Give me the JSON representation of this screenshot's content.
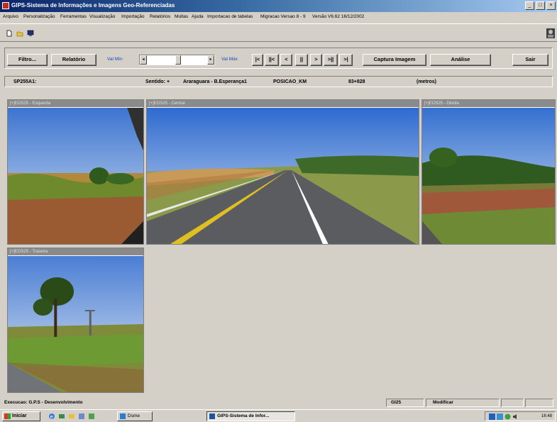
{
  "window": {
    "title": "GIPS-Sistema de Informações e Imagens Geo-Referenciadas",
    "controls": [
      "_",
      "□",
      "×"
    ]
  },
  "menu": [
    "Arquivo",
    "Personalização",
    "Ferramentas",
    "Visualização",
    "Importação",
    "Relatórios",
    "Multas",
    "Ajuda",
    "Importacao de tabelas",
    "Migracao Versao 8 - 9",
    "Versão V6.62 16/12/2002"
  ],
  "toolbar": {
    "filtro": "Filtro...",
    "relatorio": "Relatório",
    "val_min": "Val Mín",
    "val_max": "Val Máx",
    "nav": [
      "|<",
      "||<",
      "<",
      "||",
      ">",
      ">||",
      ">|"
    ],
    "captura": "Captura Imagem",
    "analise": "Análise",
    "sair": "Sair"
  },
  "info": {
    "rodovia": "SP255A1:",
    "sentido": "Sentido: +",
    "trecho": "Araraguara - B.Esperança1",
    "posicao_label": "POSICAO_KM",
    "posicao_value": "83+828",
    "unit": "(metros)"
  },
  "panels": [
    {
      "title": "[+]EOS25 - Esquerda"
    },
    {
      "title": "[+]EOS25 - Central"
    },
    {
      "title": "[+]EOS25 - Direita"
    },
    {
      "title": "[+]EOS25 - Traseira"
    }
  ],
  "status": {
    "execucao": "Execucao: G.P.S - Desenvolvimento",
    "code": "GI25",
    "modo": "Modificar"
  },
  "taskbar": {
    "start": "Iniciar",
    "tasks": [
      "Dsme",
      "GIPS-Sistema de Infor..."
    ],
    "clock": "16:48"
  },
  "colors": {
    "title_start": "#0a246a",
    "title_end": "#a6caf0",
    "window_bg": "#d4d0c8",
    "accent_blue": "#1a44c8"
  }
}
